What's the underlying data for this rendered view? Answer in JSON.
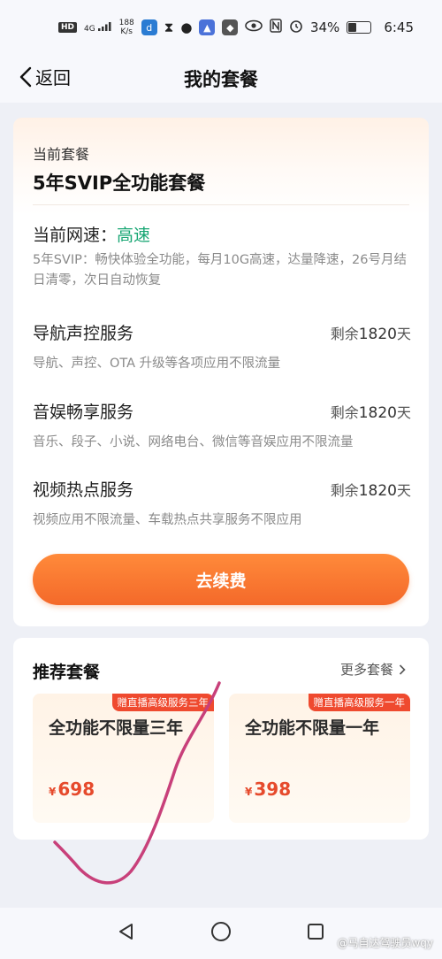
{
  "status_bar": {
    "hd": "HD",
    "network": "4G",
    "speed_value": "188",
    "speed_unit": "K/s",
    "battery": "34%",
    "time": "6:45",
    "icons": [
      "hd-icon",
      "signal-icon",
      "app-icon",
      "hourglass-icon",
      "chat-icon",
      "cap-icon",
      "app-icon",
      "eye-icon",
      "nfc-icon",
      "alarm-icon",
      "battery-icon"
    ]
  },
  "nav": {
    "back_label": "返回",
    "title": "我的套餐"
  },
  "current": {
    "label": "当前套餐",
    "plan_name": "5年SVIP全功能套餐",
    "speed_label": "当前网速：",
    "speed_value": "高速",
    "speed_desc": "5年SVIP：畅快体验全功能，每月10G高速，达量降速，26号月结日清零，次日自动恢复",
    "services": [
      {
        "title": "导航声控服务",
        "remain_prefix": "剩余",
        "remain_value": "1820",
        "remain_unit": "天",
        "desc": "导航、声控、OTA 升级等各项应用不限流量"
      },
      {
        "title": "音娱畅享服务",
        "remain_prefix": "剩余",
        "remain_value": "1820",
        "remain_unit": "天",
        "desc": "音乐、段子、小说、网络电台、微信等音娱应用不限流量"
      },
      {
        "title": "视频热点服务",
        "remain_prefix": "剩余",
        "remain_value": "1820",
        "remain_unit": "天",
        "desc": "视频应用不限流量、车载热点共享服务不限应用"
      }
    ],
    "renew_label": "去续费"
  },
  "recommend": {
    "title": "推荐套餐",
    "more_label": "更多套餐",
    "offers": [
      {
        "tag": "赠直播高级服务三年",
        "name": "全功能不限量三年",
        "currency": "¥",
        "price": "698"
      },
      {
        "tag": "赠直播高级服务一年",
        "name": "全功能不限量一年",
        "currency": "¥",
        "price": "398"
      }
    ]
  },
  "watermark": "@马自达驾驶员wqy",
  "colors": {
    "accent_orange": "#f4692a",
    "speed_green": "#17a673",
    "price_red": "#e64a2c",
    "tag_red": "#ef4a2f",
    "scribble": "#c8407a"
  }
}
